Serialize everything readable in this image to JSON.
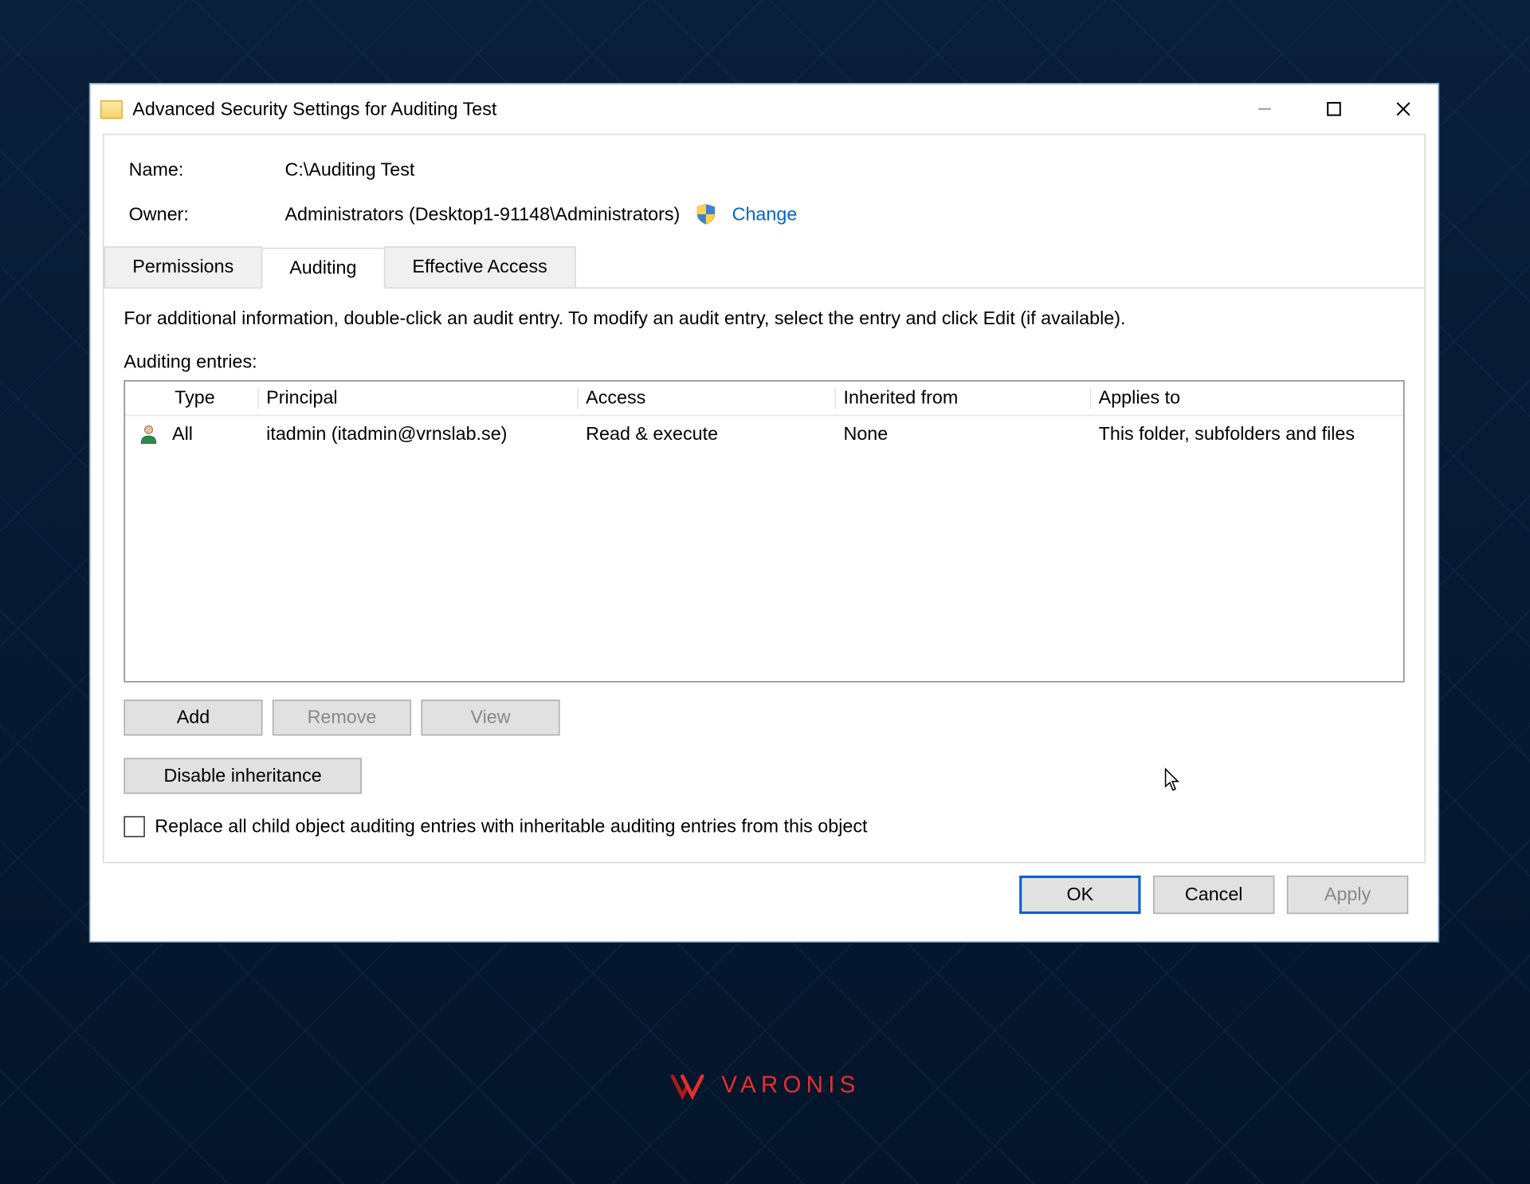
{
  "window": {
    "title": "Advanced Security Settings for Auditing Test"
  },
  "info": {
    "name_label": "Name:",
    "name_value": "C:\\Auditing Test",
    "owner_label": "Owner:",
    "owner_value": "Administrators (Desktop1-91148\\Administrators)",
    "change_link": "Change"
  },
  "tabs": {
    "permissions": "Permissions",
    "auditing": "Auditing",
    "effective": "Effective Access"
  },
  "body": {
    "instructions": "For additional information, double-click an audit entry. To modify an audit entry, select the entry and click Edit (if available).",
    "entries_label": "Auditing entries:",
    "columns": {
      "type": "Type",
      "principal": "Principal",
      "access": "Access",
      "inherited": "Inherited from",
      "applies": "Applies to"
    },
    "row": {
      "type": "All",
      "principal": "itadmin (itadmin@vrnslab.se)",
      "access": "Read & execute",
      "inherited": "None",
      "applies": "This folder, subfolders and files"
    },
    "buttons": {
      "add": "Add",
      "remove": "Remove",
      "view": "View",
      "disable_inheritance": "Disable inheritance"
    },
    "checkbox_label": "Replace all child object auditing entries with inheritable auditing entries from this object"
  },
  "footer": {
    "ok": "OK",
    "cancel": "Cancel",
    "apply": "Apply"
  },
  "brand": "VARONIS"
}
